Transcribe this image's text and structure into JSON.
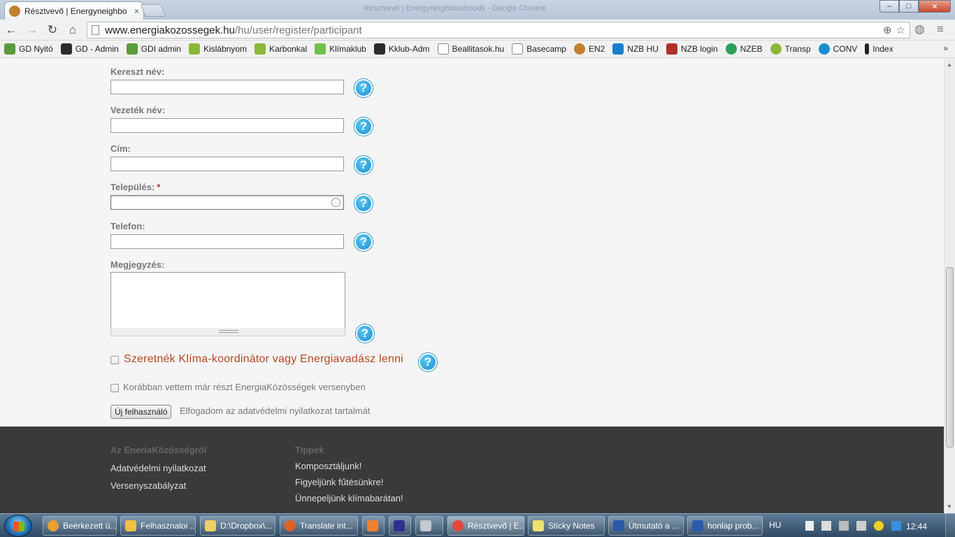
{
  "browser": {
    "tab_title": "Résztvevő | Energyneighbo",
    "tab_close": "×",
    "window_title": "Résztvevő | Energyneighbourhoods · Google Chrome",
    "url_host": "www.energiakozossegek.hu",
    "url_path": "/hu/user/register/participant",
    "window_buttons": {
      "minimize": "–",
      "maximize": "□",
      "close": "✕"
    }
  },
  "bookmarks": [
    {
      "label": "GD Nyitó",
      "color": "#5a9b3c"
    },
    {
      "label": "GD - Admin",
      "color": "#2b2b2b"
    },
    {
      "label": "GDI admin",
      "color": "#5a9b3c"
    },
    {
      "label": "Kislábnyom",
      "color": "#8ab83a"
    },
    {
      "label": "Karbonkal",
      "color": "#8ab83a"
    },
    {
      "label": "Klímaklub",
      "color": "#6fbf4a"
    },
    {
      "label": "Kklub-Adm",
      "color": "#2b2b2b"
    },
    {
      "label": "Beallitasok.hu",
      "color": "#ffffff"
    },
    {
      "label": "Basecamp",
      "color": "#ffffff"
    },
    {
      "label": "EN2",
      "color": "#c08030"
    },
    {
      "label": "NZB HU",
      "color": "#1a7fd0"
    },
    {
      "label": "NZB login",
      "color": "#b0302a"
    },
    {
      "label": "NZEB",
      "color": "#2aa05a"
    },
    {
      "label": "Transp",
      "color": "#8ab83a"
    },
    {
      "label": "CONV",
      "color": "#1a8fd0"
    },
    {
      "label": "Index",
      "color": "#222222"
    }
  ],
  "bookmarks_more": "»",
  "form": {
    "first_name_label": "Kereszt név:",
    "last_name_label": "Vezeték név:",
    "address_label": "Cím:",
    "city_label": "Település:",
    "required_mark": "*",
    "phone_label": "Telefon:",
    "note_label": "Megjegyzés:",
    "help_glyph": "?",
    "coordinator_label": "Szeretnék Klíma-koordinátor vagy Energiavadász lenni",
    "previous_label": "Korábban vettem már részt EnergiaKözösségek versenyben",
    "submit_label": "Új felhasználó",
    "accept_text": "Elfogadom az adatvédelmi nyilatkozat tartalmát"
  },
  "footer": {
    "col1_title": "Az EneriaKözösségről",
    "col1_links": [
      "Adatvédelmi nyilatkozat",
      "Versenyszabályzat"
    ],
    "col2_title": "Tippek",
    "col2_links": [
      "Komposztáljunk!",
      "Figyeljünk fűtésünkre!",
      "Ünnepeljünk klímabarátan!"
    ]
  },
  "taskbar": {
    "items": [
      {
        "label": "Beérkezett ü...",
        "color": "#e8a030"
      },
      {
        "label": "Felhasznaloi ...",
        "color": "#f0c040"
      },
      {
        "label": "D:\\Dropbox\\...",
        "color": "#f0d060"
      },
      {
        "label": "Translate int...",
        "color": "#e06020"
      },
      {
        "label": "",
        "color": "#f08030"
      },
      {
        "label": "",
        "color": "#303090"
      },
      {
        "label": "",
        "color": "#c0c8d0"
      },
      {
        "label": "Résztvevő | E...",
        "color": "#e04a3a"
      },
      {
        "label": "Sticky Notes",
        "color": "#f0e070"
      },
      {
        "label": "Útmutató a ...",
        "color": "#2a5aa8"
      },
      {
        "label": "honlap prob...",
        "color": "#2a5aa8"
      }
    ],
    "lang": "HU",
    "clock": "12:44"
  }
}
